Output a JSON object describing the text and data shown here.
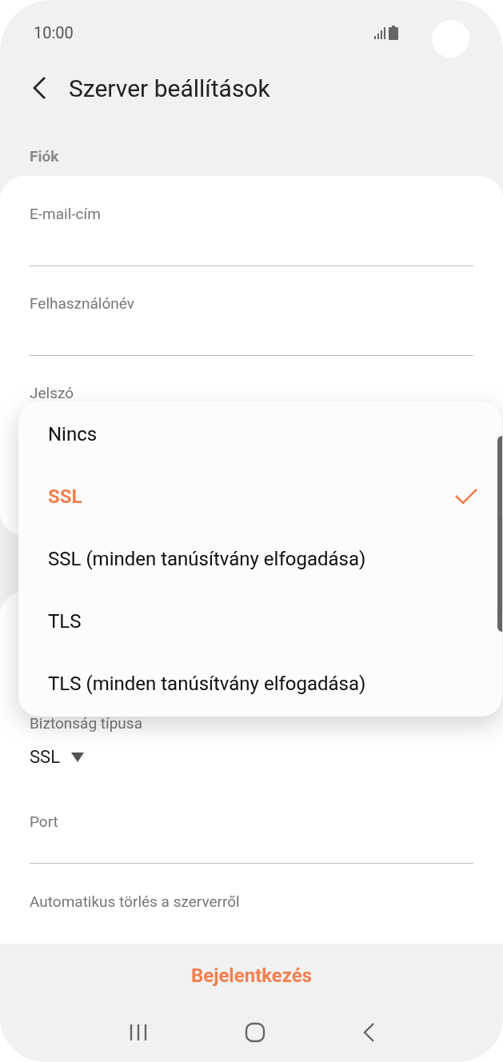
{
  "status_bar": {
    "time": "10:00"
  },
  "header": {
    "title": "Szerver beállítások"
  },
  "section": {
    "title": "Fiók"
  },
  "account_fields": [
    {
      "label": "E-mail-cím"
    },
    {
      "label": "Felhasználónév"
    },
    {
      "label": "Jelszó"
    }
  ],
  "server_fields": [
    {
      "kind": "select",
      "label": "Biztonság típusa",
      "value": "SSL"
    },
    {
      "kind": "text",
      "label": "Port"
    },
    {
      "kind": "setting",
      "label": "Automatikus törlés a szerverről"
    }
  ],
  "menu": {
    "options": [
      {
        "label": "Nincs",
        "selected": false
      },
      {
        "label": "SSL",
        "selected": true
      },
      {
        "label": "SSL (minden tanúsítvány elfogadása)",
        "selected": false
      },
      {
        "label": "TLS",
        "selected": false
      },
      {
        "label": "TLS (minden tanúsítvány elfogadása)",
        "selected": false
      }
    ]
  },
  "footer": {
    "button": "Bejelentkezés"
  }
}
